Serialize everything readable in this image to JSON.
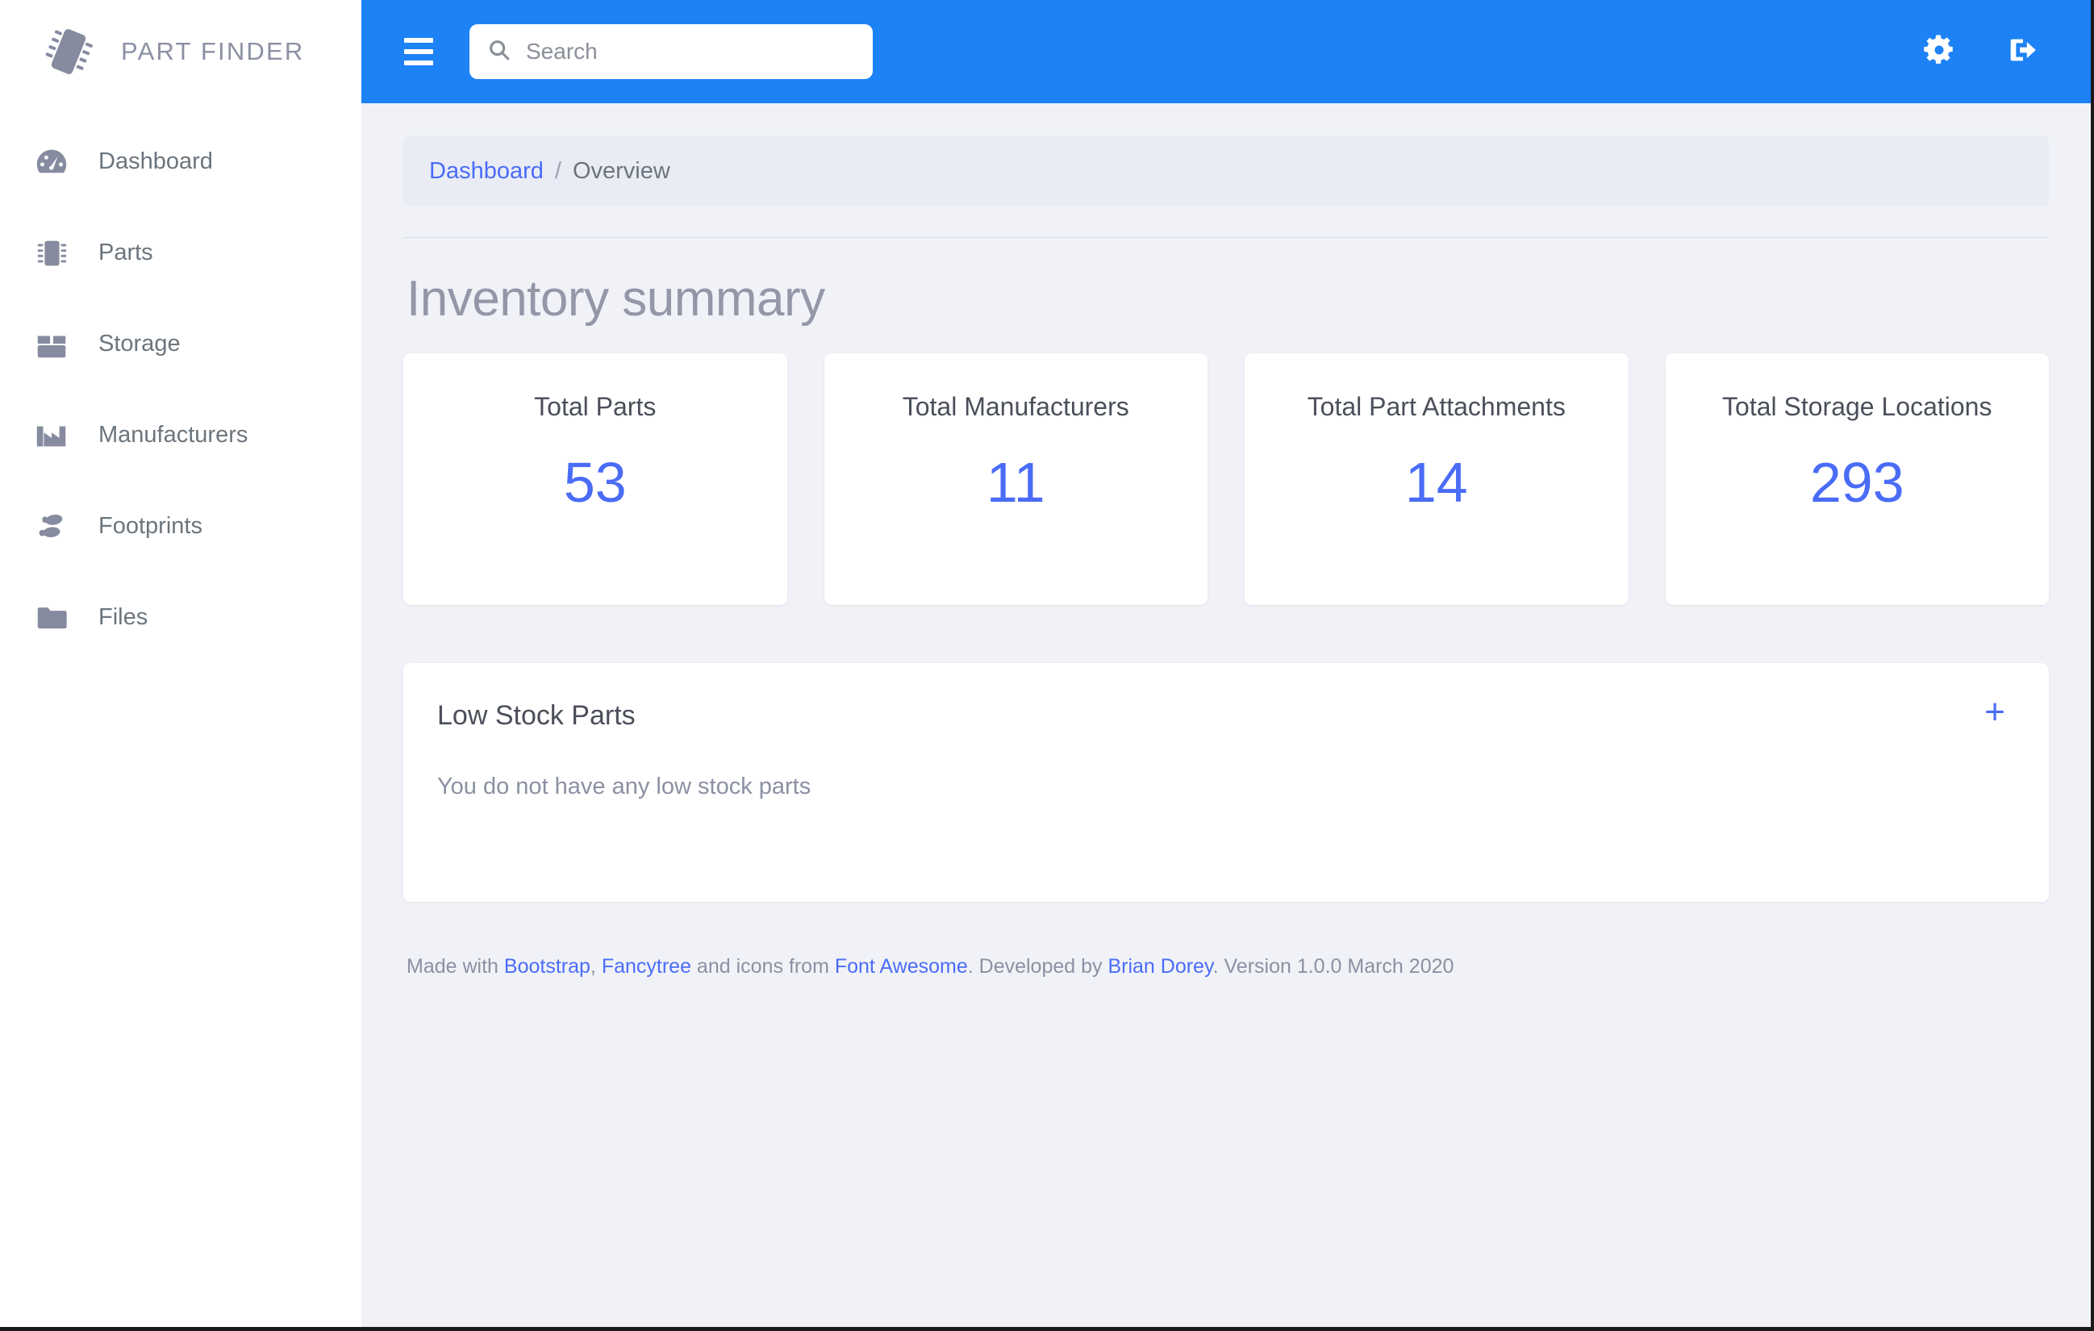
{
  "brand": {
    "title": "PART FINDER",
    "logo_icon": "microchip-icon"
  },
  "sidebar": {
    "items": [
      {
        "label": "Dashboard",
        "icon": "tachometer-icon"
      },
      {
        "label": "Parts",
        "icon": "microchip-icon"
      },
      {
        "label": "Storage",
        "icon": "box-open-icon"
      },
      {
        "label": "Manufacturers",
        "icon": "industry-icon"
      },
      {
        "label": "Footprints",
        "icon": "shoe-prints-icon"
      },
      {
        "label": "Files",
        "icon": "folder-icon"
      }
    ]
  },
  "topbar": {
    "menu_icon": "hamburger-icon",
    "search": {
      "placeholder": "Search",
      "value": "",
      "icon": "search-icon"
    },
    "settings_icon": "gear-icon",
    "logout_icon": "sign-out-icon",
    "background_color": "#1d82f5"
  },
  "breadcrumb": {
    "link_label": "Dashboard",
    "separator": "/",
    "current_label": "Overview"
  },
  "main": {
    "page_title": "Inventory summary",
    "accent_color": "#4a6cf7",
    "cards": [
      {
        "title": "Total Parts",
        "value": "53"
      },
      {
        "title": "Total Manufacturers",
        "value": "11"
      },
      {
        "title": "Total Part Attachments",
        "value": "14"
      },
      {
        "title": "Total Storage Locations",
        "value": "293"
      }
    ],
    "low_stock_panel": {
      "title": "Low Stock Parts",
      "add_label": "+",
      "empty_message": "You do not have any low stock parts"
    }
  },
  "footer": {
    "made_with": "Made with ",
    "bootstrap": "Bootstrap",
    "comma": ", ",
    "fancytree": "Fancytree",
    "icons_from": " and icons from ",
    "font_awesome": "Font Awesome",
    "developed_by": ". Developed by ",
    "author": "Brian Dorey",
    "version": ". Version 1.0.0 March 2020"
  }
}
